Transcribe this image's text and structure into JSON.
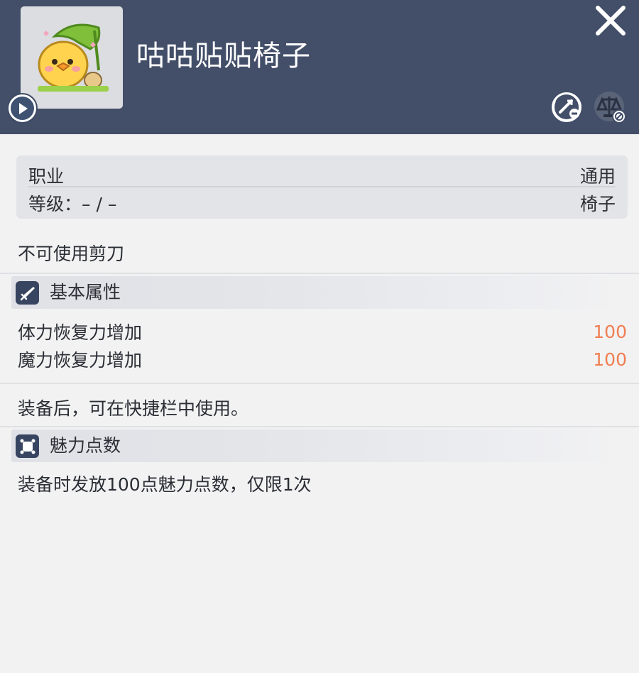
{
  "item": {
    "name": "咕咕贴贴椅子",
    "icon": "duck-chair-icon"
  },
  "header_icons": {
    "close": "close-icon",
    "play": "play-icon",
    "trade": "trade-restricted-icon",
    "compare": "compare-disabled-icon"
  },
  "info": {
    "job_label": "职业",
    "job_value": "通用",
    "level_label": "等级：– / –",
    "type_value": "椅子"
  },
  "note_scissors": "不可使用剪刀",
  "sections": [
    {
      "title": "基本属性",
      "icon": "sword-icon"
    },
    {
      "title": "魅力点数",
      "icon": "charm-icon"
    }
  ],
  "stats": [
    {
      "name": "体力恢复力增加",
      "value": "100"
    },
    {
      "name": "魔力恢复力增加",
      "value": "100"
    }
  ],
  "note_quickbar": "装备后，可在快捷栏中使用。",
  "charm_desc": "装备时发放100点魅力点数，仅限1次",
  "colors": {
    "header_bg": "#434f69",
    "body_bg": "#f2f2f2",
    "stat_value": "#f07e53",
    "badge_bg": "#384561"
  }
}
